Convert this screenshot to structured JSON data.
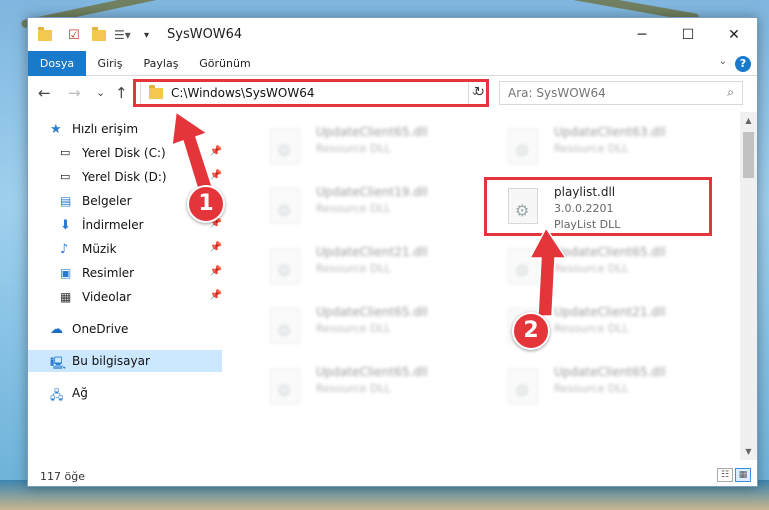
{
  "window": {
    "title": "SysWOW64",
    "minimize_glyph": "─",
    "maximize_glyph": "☐",
    "close_glyph": "✕"
  },
  "ribbon": {
    "tabs": [
      {
        "label": "Dosya",
        "active": true
      },
      {
        "label": "Giriş",
        "active": false
      },
      {
        "label": "Paylaş",
        "active": false
      },
      {
        "label": "Görünüm",
        "active": false
      }
    ],
    "help": "?"
  },
  "nav": {
    "back": "←",
    "forward": "→",
    "recent": "⌄",
    "up": "↑",
    "address_path": "C:\\Windows\\SysWOW64",
    "refresh": "↻",
    "search_placeholder": "Ara: SysWOW64",
    "search_icon": "search-icon"
  },
  "sidebar": {
    "items": [
      {
        "label": "Hızlı erişim",
        "icon": "star-icon",
        "pinned": false
      },
      {
        "label": "Yerel Disk (C:)",
        "icon": "drive-icon",
        "pinned": true
      },
      {
        "label": "Yerel Disk (D:)",
        "icon": "drive-icon",
        "pinned": true
      },
      {
        "label": "Belgeler",
        "icon": "documents-icon",
        "pinned": true
      },
      {
        "label": "İndirmeler",
        "icon": "download-icon",
        "pinned": true
      },
      {
        "label": "Müzik",
        "icon": "music-icon",
        "pinned": true
      },
      {
        "label": "Resimler",
        "icon": "pictures-icon",
        "pinned": true
      },
      {
        "label": "Videolar",
        "icon": "video-icon",
        "pinned": true
      },
      {
        "label": "OneDrive",
        "icon": "cloud-icon",
        "pinned": false
      },
      {
        "label": "Bu bilgisayar",
        "icon": "computer-icon",
        "pinned": false
      },
      {
        "label": "Ağ",
        "icon": "network-icon",
        "pinned": false
      }
    ]
  },
  "files": {
    "left": [
      {
        "name": "UpdateClient65.dll",
        "line2": "Resource DLL",
        "line3": ""
      },
      {
        "name": "UpdateClient19.dll",
        "line2": "Resource DLL",
        "line3": ""
      },
      {
        "name": "UpdateClient21.dll",
        "line2": "Resource DLL",
        "line3": ""
      },
      {
        "name": "UpdateClient65.dll",
        "line2": "Resource DLL",
        "line3": ""
      },
      {
        "name": "UpdateClient65.dll",
        "line2": "Resource DLL",
        "line3": ""
      }
    ],
    "right": [
      {
        "name": "UpdateClient63.dll",
        "line2": "Resource DLL",
        "line3": ""
      },
      {
        "name": "playlist.dll",
        "line2": "3.0.0.2201",
        "line3": "PlayList DLL"
      },
      {
        "name": "UpdateClient65.dll",
        "line2": "Resource DLL",
        "line3": ""
      },
      {
        "name": "UpdateClient21.dll",
        "line2": "Resource DLL",
        "line3": ""
      },
      {
        "name": "UpdateClient65.dll",
        "line2": "Resource DLL",
        "line3": ""
      }
    ]
  },
  "status": {
    "item_count": "117 öğe"
  },
  "annotations": {
    "step1": "1",
    "step2": "2",
    "color": "#e3353a"
  }
}
